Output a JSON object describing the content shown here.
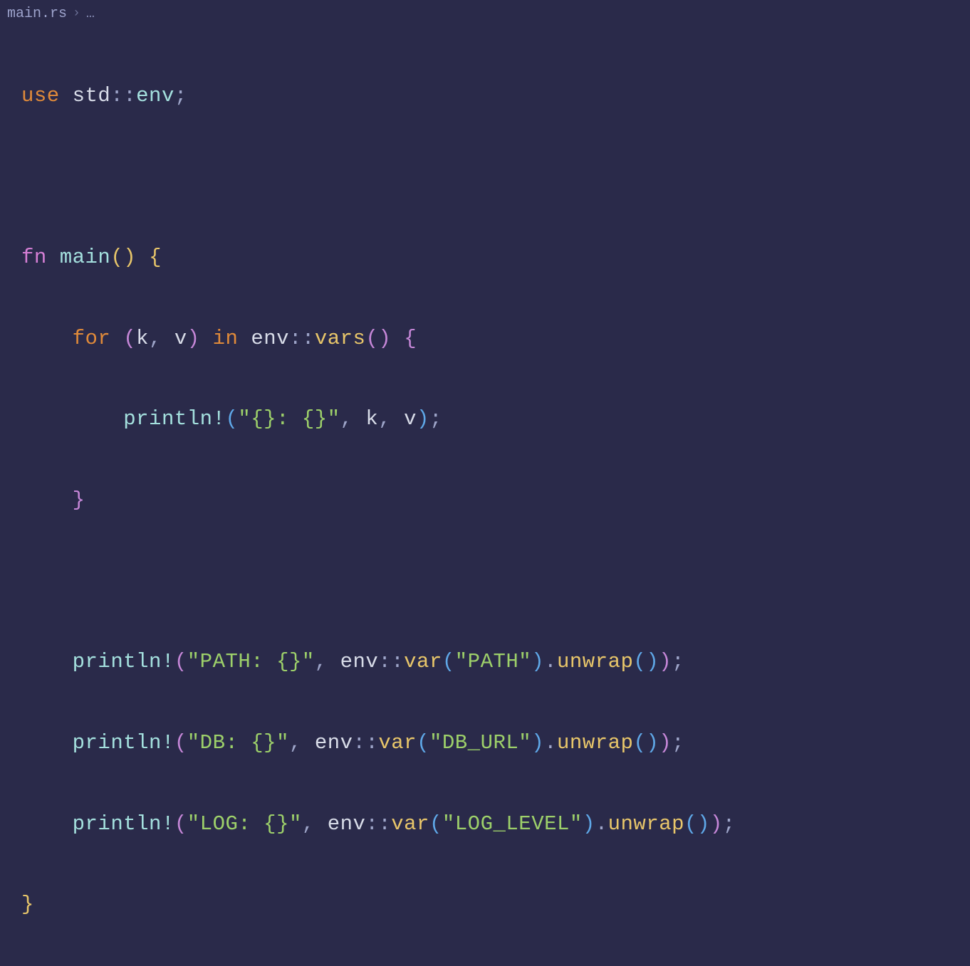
{
  "breadcrumb": {
    "file": "main.rs",
    "separator": "›",
    "ellipsis": "…"
  },
  "code": {
    "line1": {
      "use": "use",
      "std": "std",
      "sep": "::",
      "env": "env",
      "semi": ";"
    },
    "line3": {
      "fn": "fn",
      "main": "main",
      "parens": "()",
      "brace": "{"
    },
    "line4": {
      "indent": "    ",
      "for": "for",
      "lparen": "(",
      "k": "k",
      "comma": ", ",
      "v": "v",
      "rparen": ")",
      "in": "in",
      "env": "env",
      "sep": "::",
      "vars": "vars",
      "parens": "()",
      "brace": "{"
    },
    "line5": {
      "indent": "        ",
      "println": "println!",
      "lparen": "(",
      "str": "\"{}: {}\"",
      "c1": ", ",
      "k": "k",
      "c2": ", ",
      "v": "v",
      "rparen": ")",
      "semi": ";"
    },
    "line6": {
      "indent": "    ",
      "brace": "}"
    },
    "line8": {
      "indent": "    ",
      "println": "println!",
      "lparen": "(",
      "str1": "\"PATH: {}\"",
      "c1": ", ",
      "env": "env",
      "sep": "::",
      "var": "var",
      "lparen2": "(",
      "str2": "\"PATH\"",
      "rparen2": ")",
      "dot": ".",
      "unwrap": "unwrap",
      "lparen3": "(",
      "rparen3": ")",
      "rparen": ")",
      "semi": ";"
    },
    "line9": {
      "indent": "    ",
      "println": "println!",
      "lparen": "(",
      "str1": "\"DB: {}\"",
      "c1": ", ",
      "env": "env",
      "sep": "::",
      "var": "var",
      "lparen2": "(",
      "str2": "\"DB_URL\"",
      "rparen2": ")",
      "dot": ".",
      "unwrap": "unwrap",
      "lparen3": "(",
      "rparen3": ")",
      "rparen": ")",
      "semi": ";"
    },
    "line10": {
      "indent": "    ",
      "println": "println!",
      "lparen": "(",
      "str1": "\"LOG: {}\"",
      "c1": ", ",
      "env": "env",
      "sep": "::",
      "var": "var",
      "lparen2": "(",
      "str2": "\"LOG_LEVEL\"",
      "rparen2": ")",
      "dot": ".",
      "unwrap": "unwrap",
      "lparen3": "(",
      "rparen3": ")",
      "rparen": ")",
      "semi": ";"
    },
    "line11": {
      "brace": "}"
    }
  }
}
